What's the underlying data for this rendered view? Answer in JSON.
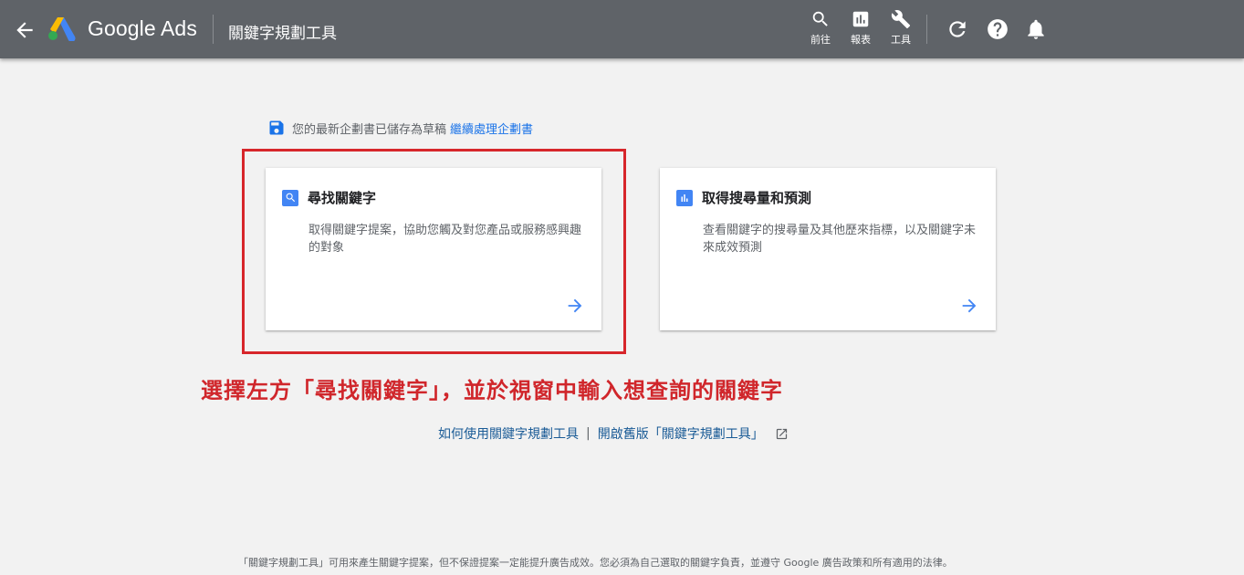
{
  "header": {
    "brand": "Google Ads",
    "page_title": "關鍵字規劃工具",
    "tools": [
      {
        "label": "前往",
        "icon": "search-icon"
      },
      {
        "label": "報表",
        "icon": "bar-chart-icon"
      },
      {
        "label": "工具",
        "icon": "wrench-icon"
      }
    ],
    "icons": [
      "refresh-icon",
      "help-icon",
      "bell-icon"
    ]
  },
  "draft_notice": {
    "text": "您的最新企劃書已儲存為草稿",
    "link": "繼續處理企劃書"
  },
  "cards": [
    {
      "title": "尋找關鍵字",
      "description": "取得關鍵字提案，協助您觸及對您產品或服務感興趣的對象",
      "icon": "search-icon"
    },
    {
      "title": "取得搜尋量和預測",
      "description": "查看關鍵字的搜尋量及其他歷來指標，以及關鍵字未來成效預測",
      "icon": "bar-chart-icon"
    }
  ],
  "annotation": "選擇左方「尋找關鍵字」，並於視窗中輸入想查詢的關鍵字",
  "help_links": {
    "how_to": "如何使用關鍵字規劃工具",
    "separator": "|",
    "old_version": "開啟舊版「關鍵字規劃工具」"
  },
  "footer": "「關鍵字規劃工具」可用來產生關鍵字提案，但不保證提案一定能提升廣告成效。您必須為自己選取的關鍵字負責，並遵守 Google 廣告政策和所有適用的法律。",
  "colors": {
    "header_bg": "#5f6368",
    "accent_blue": "#4285f4",
    "link_blue": "#1a73e8",
    "annotation_red": "#d0262b"
  }
}
